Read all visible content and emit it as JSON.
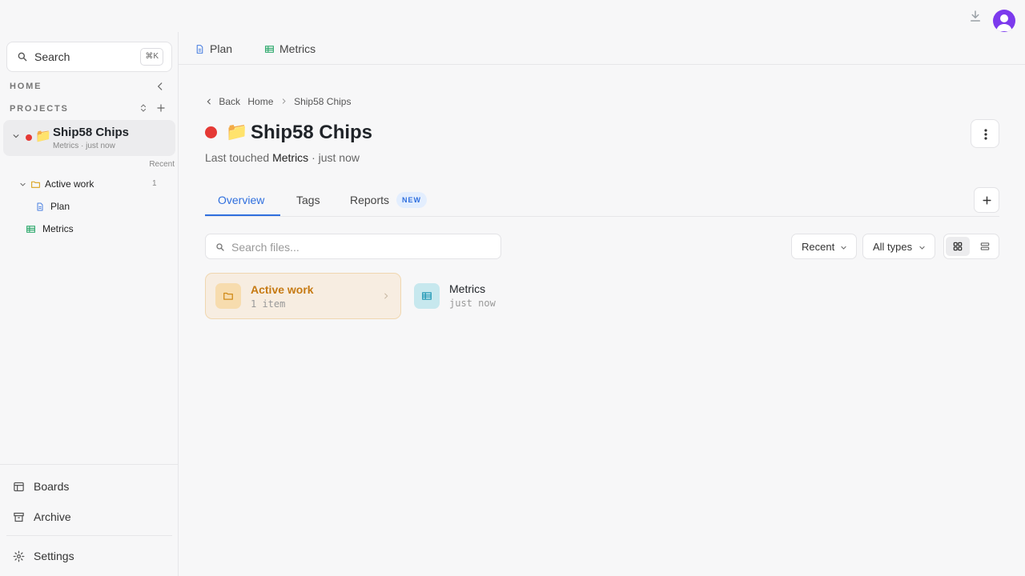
{
  "colors": {
    "accent": "#2f6fde",
    "project_dot": "#e53935",
    "folder": "#d08a17",
    "sheet": "#1a94b3"
  },
  "sidebar": {
    "search_label": "Search",
    "search_shortcut": "⌘K",
    "home_label": "HOME",
    "projects_label": "PROJECTS",
    "project": {
      "name": "Ship58 Chips",
      "subtitle": "Metrics · just now",
      "icon": "folder-emoji"
    },
    "recent_label": "Recent",
    "tree": [
      {
        "label": "Active work",
        "count": "1",
        "icon": "folder-icon"
      },
      {
        "label": "Plan",
        "icon": "doc-icon"
      },
      {
        "label": "Metrics",
        "icon": "sheet-icon"
      }
    ],
    "nav": [
      {
        "label": "Boards",
        "icon": "boards-icon"
      },
      {
        "label": "Archive",
        "icon": "archive-icon"
      },
      {
        "label": "Settings",
        "icon": "gear-icon"
      }
    ]
  },
  "file_tabs": [
    {
      "label": "Plan",
      "icon": "doc-icon"
    },
    {
      "label": "Metrics",
      "icon": "sheet-icon"
    }
  ],
  "breadcrumb": {
    "back": "Back",
    "home": "Home",
    "current": "Ship58 Chips"
  },
  "page": {
    "title": "Ship58 Chips",
    "touched_prefix": "Last touched",
    "touched_item": "Metrics",
    "touched_suffix": "· just now"
  },
  "tabs": [
    {
      "label": "Overview",
      "active": true
    },
    {
      "label": "Tags"
    },
    {
      "label": "Reports",
      "badge": "NEW"
    }
  ],
  "toolbar": {
    "search_placeholder": "Search files...",
    "sort_label": "Recent",
    "type_label": "All types"
  },
  "items": [
    {
      "name": "Active work",
      "sub": "1 item",
      "kind": "folder"
    },
    {
      "name": "Metrics",
      "sub": "just now",
      "kind": "sheet"
    }
  ]
}
